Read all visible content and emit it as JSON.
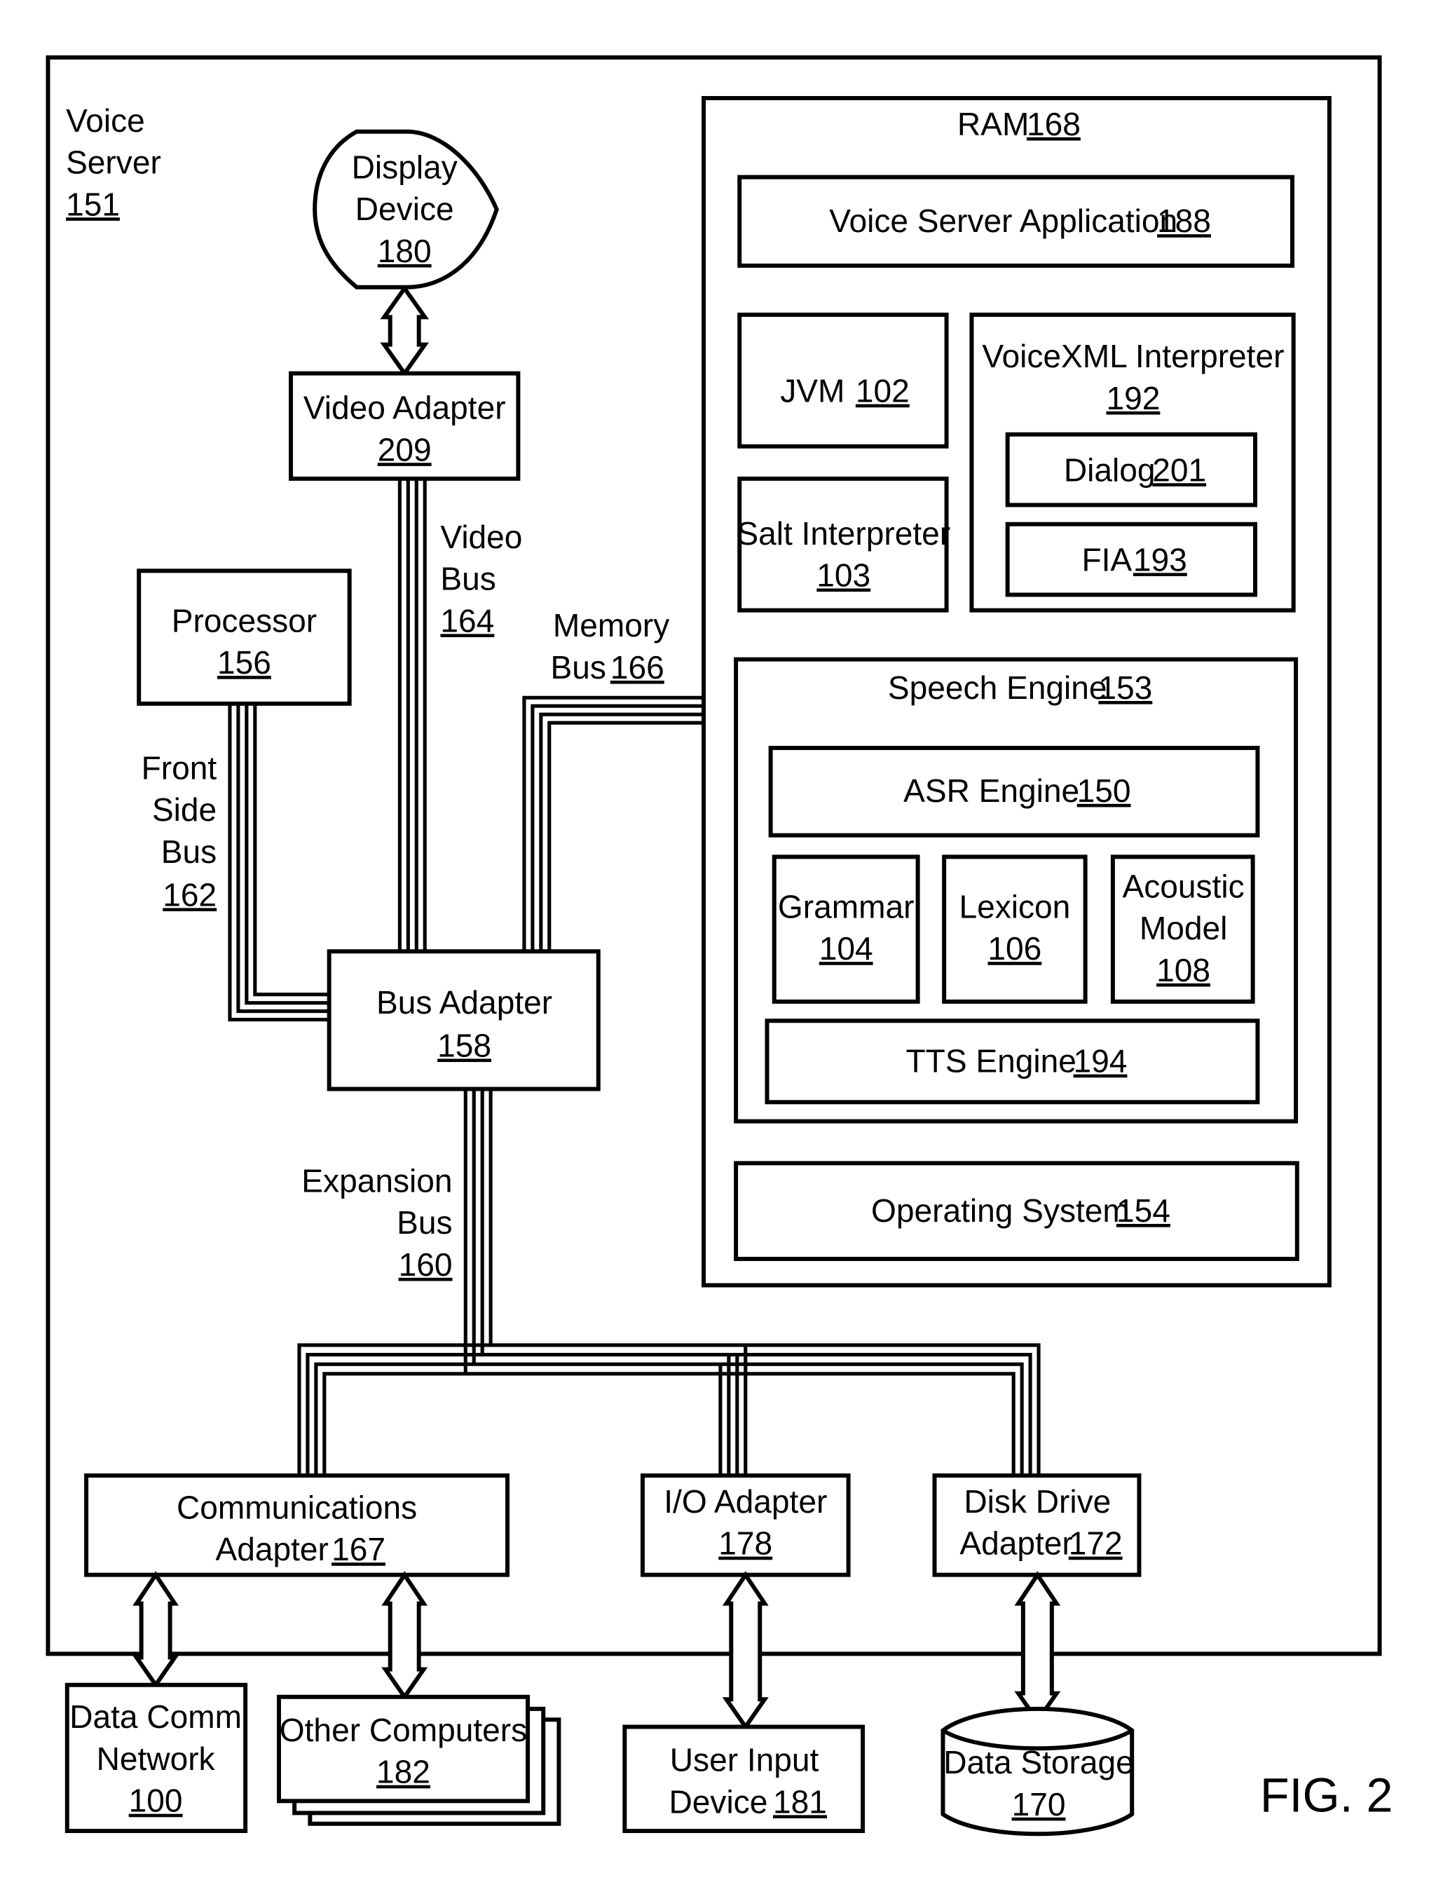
{
  "figure_label": "FIG. 2",
  "voice_server": {
    "line1": "Voice",
    "line2": "Server",
    "ref": "151"
  },
  "display_device": {
    "line1": "Display",
    "line2": "Device",
    "ref": "180"
  },
  "video_adapter": {
    "line1": "Video Adapter",
    "ref": "209"
  },
  "video_bus": {
    "line1": "Video",
    "line2": "Bus",
    "ref": "164"
  },
  "processor": {
    "line1": "Processor",
    "ref": "156"
  },
  "front_side_bus": {
    "line1": "Front",
    "line2": "Side",
    "line3": "Bus",
    "ref": "162"
  },
  "memory_bus": {
    "line1": "Memory",
    "line2": "Bus",
    "ref": "166"
  },
  "bus_adapter": {
    "line1": "Bus Adapter",
    "ref": "158"
  },
  "expansion_bus": {
    "line1": "Expansion",
    "line2": "Bus",
    "ref": "160"
  },
  "ram": {
    "label": "RAM",
    "ref": "168",
    "voice_server_app": {
      "label": "Voice Server Application",
      "ref": "188"
    },
    "jvm": {
      "label": "JVM",
      "ref": "102"
    },
    "salt": {
      "line1": "Salt Interpreter",
      "ref": "103"
    },
    "voicexml": {
      "line1": "VoiceXML Interpreter",
      "ref": "192",
      "dialog": {
        "label": "Dialog",
        "ref": "201"
      },
      "fia": {
        "label": "FIA",
        "ref": "193"
      }
    },
    "speech_engine": {
      "label": "Speech Engine",
      "ref": "153",
      "asr": {
        "label": "ASR Engine",
        "ref": "150"
      },
      "grammar": {
        "line1": "Grammar",
        "ref": "104"
      },
      "lexicon": {
        "line1": "Lexicon",
        "ref": "106"
      },
      "acoustic": {
        "line1": "Acoustic",
        "line2": "Model",
        "ref": "108"
      },
      "tts": {
        "label": "TTS Engine",
        "ref": "194"
      }
    },
    "os": {
      "label": "Operating System",
      "ref": "154"
    }
  },
  "comm_adapter": {
    "line1": "Communications",
    "line2": "Adapter",
    "ref": "167"
  },
  "io_adapter": {
    "line1": "I/O Adapter",
    "ref": "178"
  },
  "disk_adapter": {
    "line1": "Disk Drive",
    "line2": "Adapter",
    "ref": "172"
  },
  "data_comm": {
    "line1": "Data Comm",
    "line2": "Network",
    "ref": "100"
  },
  "other_computers": {
    "line1": "Other Computers",
    "ref": "182"
  },
  "user_input": {
    "line1": "User Input",
    "line2": "Device",
    "ref": "181"
  },
  "data_storage": {
    "line1": "Data Storage",
    "ref": "170"
  }
}
